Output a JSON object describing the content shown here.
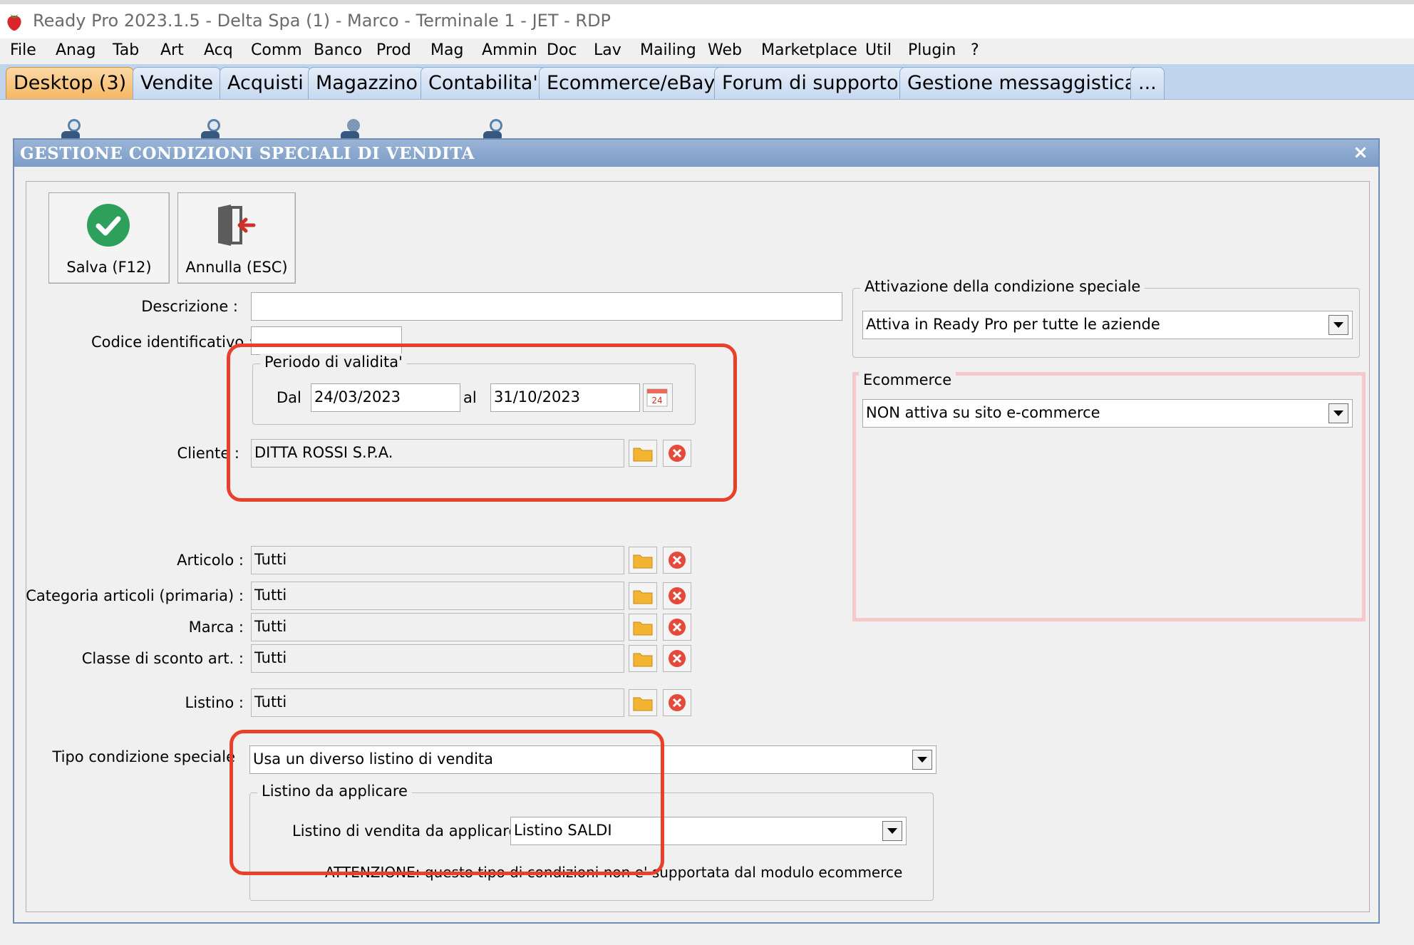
{
  "window": {
    "title": "Ready Pro 2023.1.5 - Delta Spa (1) - Marco - Terminale 1 - JET - RDP"
  },
  "menu": [
    "File",
    "Anag",
    "Tab",
    "Art",
    "Acq",
    "Comm",
    "Banco",
    "Prod",
    "Mag",
    "Ammin",
    "Doc",
    "Lav",
    "Mailing",
    "Web",
    "Marketplace",
    "Util",
    "Plugin",
    "?"
  ],
  "tabs": [
    "Desktop (3)",
    "Vendite",
    "Acquisti",
    "Magazzino",
    "Contabilita'",
    "Ecommerce/eBay",
    "Forum di supporto",
    "Gestione messaggistica",
    "..."
  ],
  "dialog": {
    "title": "GESTIONE CONDIZIONI SPECIALI DI VENDITA",
    "close": "×",
    "toolbar": {
      "save": "Salva (F12)",
      "cancel": "Annulla (ESC)"
    },
    "labels": {
      "descrizione": "Descrizione :",
      "codice": "Codice identificativo :",
      "periodo": "Periodo di validita'",
      "dal": "Dal",
      "al": "al",
      "cliente": "Cliente :",
      "articolo": "Articolo :",
      "categoria": "Categoria articoli (primaria) :",
      "marca": "Marca :",
      "classe": "Classe di sconto art. :",
      "listino": "Listino :",
      "tipo": "Tipo condizione speciale",
      "listino_group": "Listino da applicare",
      "listino_vendita": "Listino di vendita da applicare :",
      "attivazione": "Attivazione della condizione speciale",
      "ecommerce": "Ecommerce"
    },
    "values": {
      "descrizione": "",
      "codice": "",
      "dal": "24/03/2023",
      "al": "31/10/2023",
      "cliente": "DITTA ROSSI S.P.A.",
      "articolo": "Tutti",
      "categoria": "Tutti",
      "marca": "Tutti",
      "classe": "Tutti",
      "listino": "Tutti",
      "tipo": "Usa un diverso listino di vendita",
      "listino_vendita": "Listino SALDI",
      "attivazione": "Attiva in Ready Pro per tutte le aziende",
      "ecommerce": "NON attiva su sito e-commerce"
    },
    "calendar_day": "24",
    "warning": "ATTENZIONE: questo tipo di condizioni non e' supportata dal modulo ecommerce"
  },
  "colors": {
    "highlight": "#e8402a",
    "accent_tab": "#f5b764",
    "header": "#7c9dc6"
  }
}
